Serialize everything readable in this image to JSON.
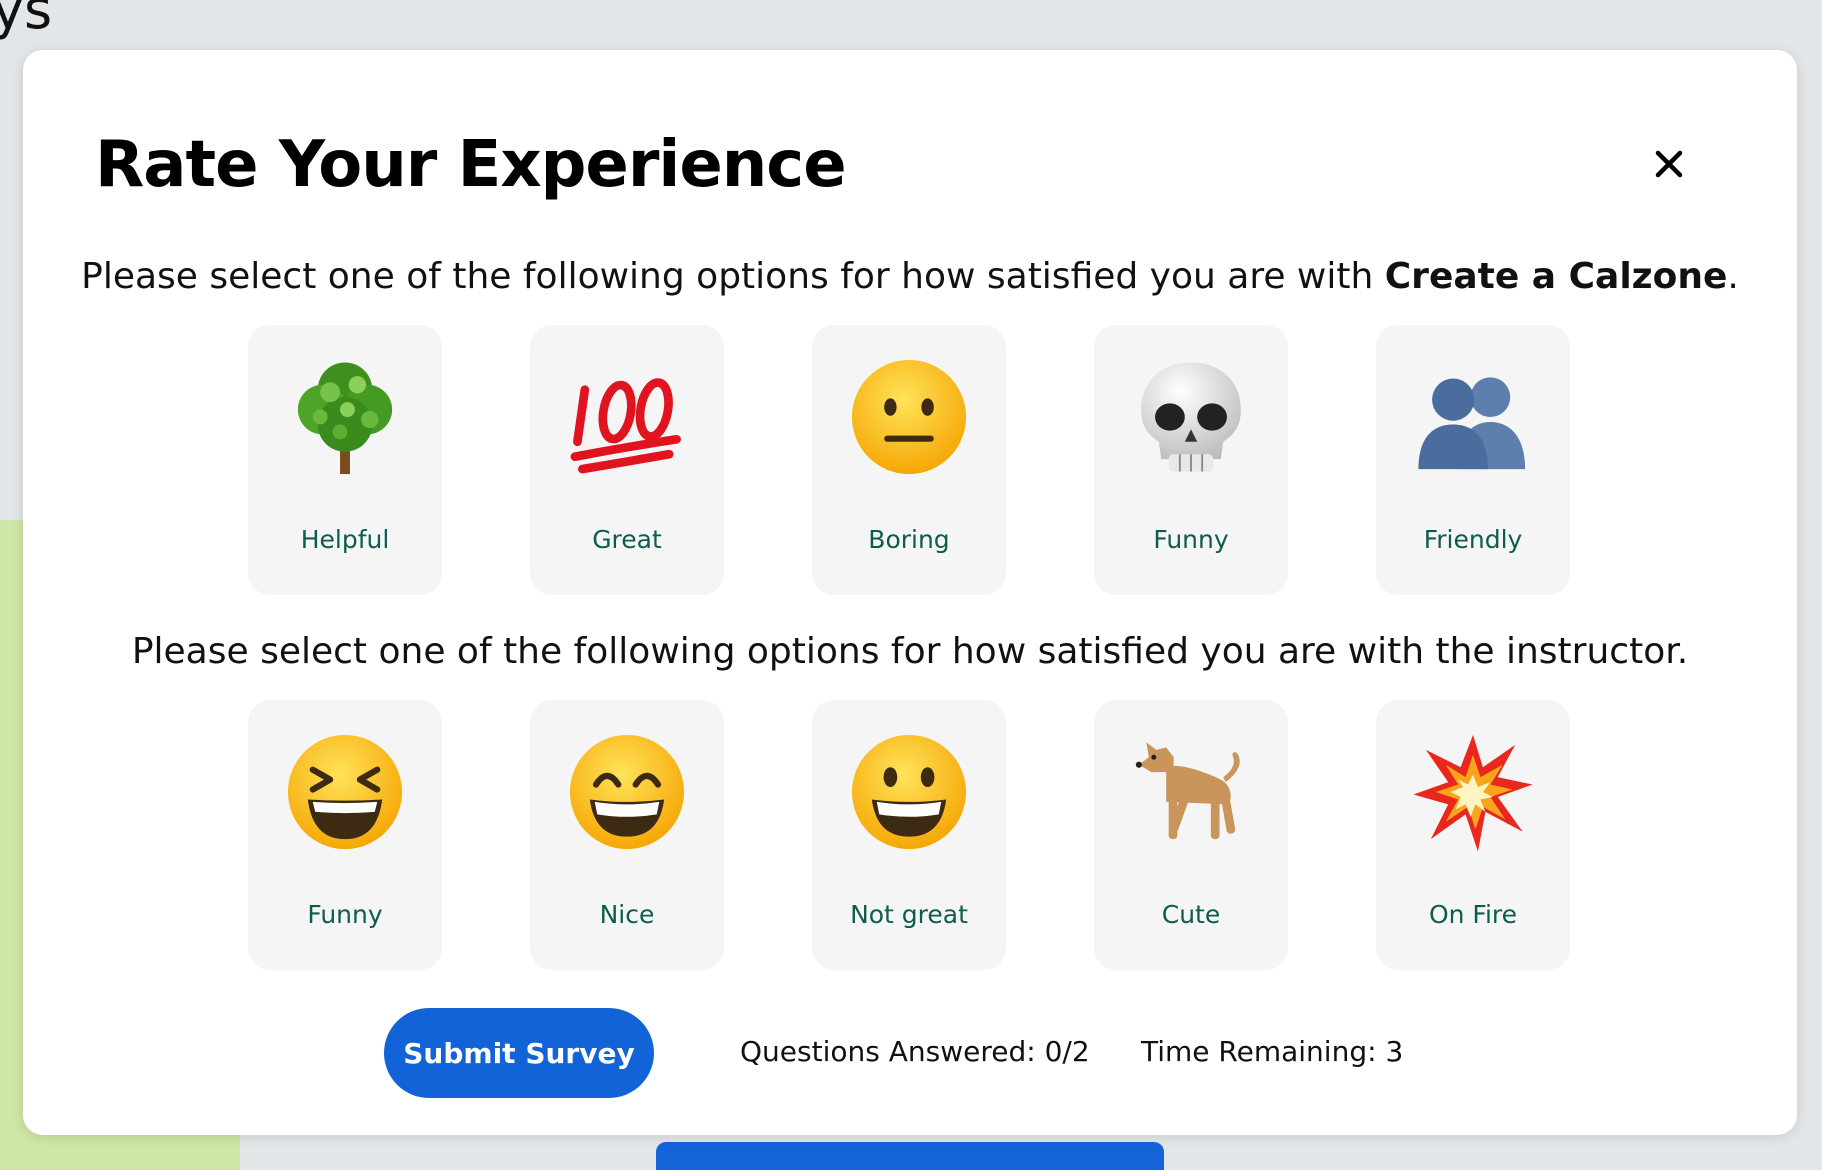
{
  "background": {
    "partial_text": "ys"
  },
  "modal": {
    "title": "Rate Your Experience",
    "close_icon": "close-icon"
  },
  "questions": [
    {
      "prompt_prefix": "Please select one of the following options for how satisfied you are with ",
      "prompt_bold": "Create a Calzone",
      "prompt_suffix": ".",
      "options": [
        {
          "label": "Helpful",
          "icon": "tree-icon"
        },
        {
          "label": "Great",
          "icon": "hundred-points-icon"
        },
        {
          "label": "Boring",
          "icon": "neutral-face-icon"
        },
        {
          "label": "Funny",
          "icon": "skull-icon"
        },
        {
          "label": "Friendly",
          "icon": "busts-in-silhouette-icon"
        }
      ]
    },
    {
      "prompt_prefix": "Please select one of the following options for how satisfied you are with the instructor.",
      "prompt_bold": "",
      "prompt_suffix": "",
      "options": [
        {
          "label": "Funny",
          "icon": "laughing-face-icon"
        },
        {
          "label": "Nice",
          "icon": "grinning-smiling-eyes-icon"
        },
        {
          "label": "Not great",
          "icon": "grinning-face-icon"
        },
        {
          "label": "Cute",
          "icon": "dog-icon"
        },
        {
          "label": "On Fire",
          "icon": "collision-icon"
        }
      ]
    }
  ],
  "footer": {
    "submit_label": "Submit Survey",
    "questions_answered": "Questions Answered: 0/2",
    "time_remaining": "Time Remaining: 3"
  },
  "colors": {
    "accent": "#1263d8",
    "label_text": "#0d5c4f",
    "card_bg": "#f5f5f5"
  }
}
